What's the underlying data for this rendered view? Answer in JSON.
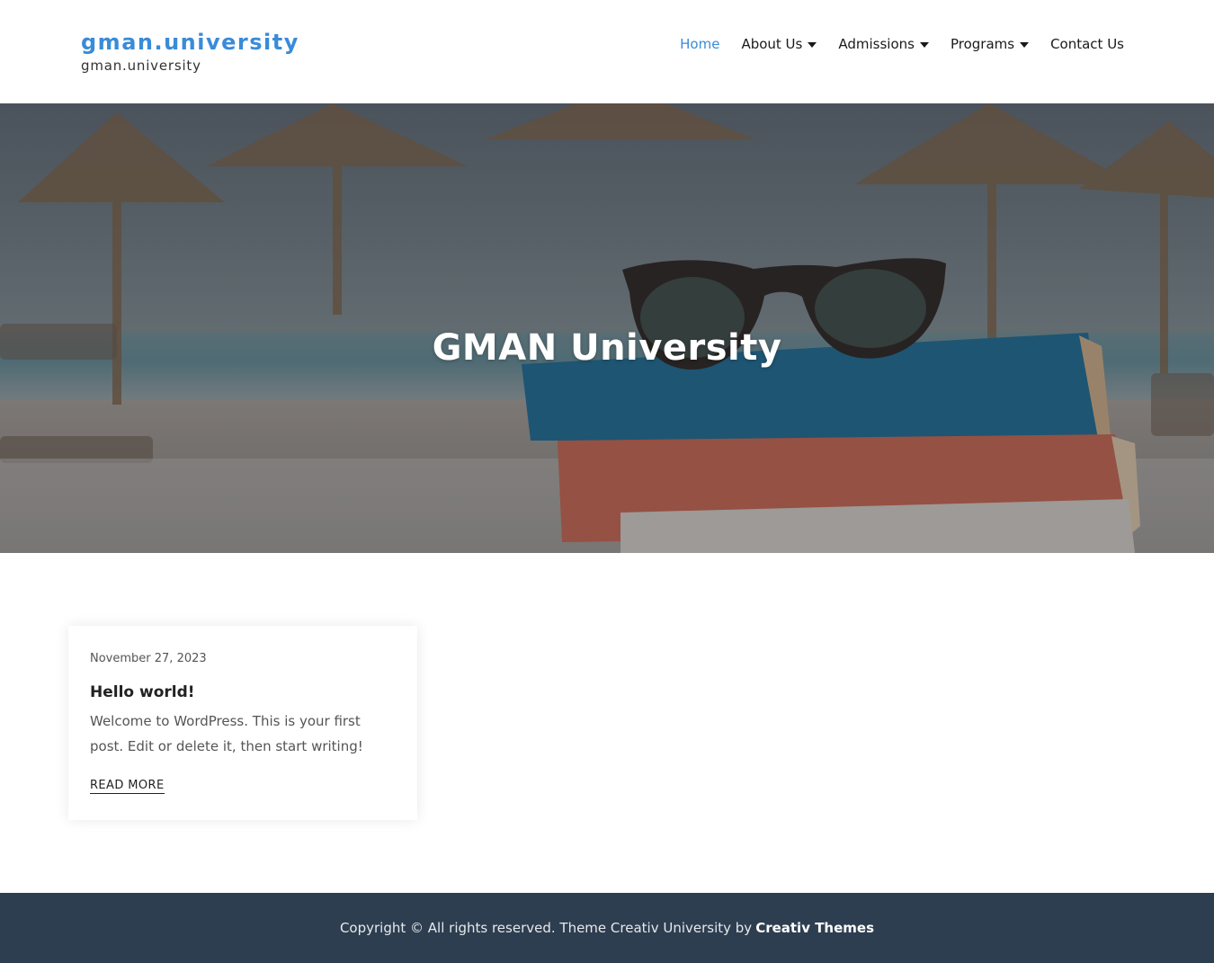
{
  "header": {
    "site_title": "gman.university",
    "tagline": "gman.university",
    "nav": [
      {
        "label": "Home",
        "active": true,
        "has_dropdown": false
      },
      {
        "label": "About Us",
        "active": false,
        "has_dropdown": true
      },
      {
        "label": "Admissions",
        "active": false,
        "has_dropdown": true
      },
      {
        "label": "Programs",
        "active": false,
        "has_dropdown": true
      },
      {
        "label": "Contact Us",
        "active": false,
        "has_dropdown": false
      }
    ]
  },
  "hero": {
    "title": "GMAN University"
  },
  "posts": [
    {
      "date": "November 27, 2023",
      "title": "Hello world!",
      "excerpt": "Welcome to WordPress. This is your first post. Edit or delete it, then start writing!",
      "read_more": "READ MORE"
    }
  ],
  "footer": {
    "text": "Copyright © All rights reserved. Theme Creativ University by",
    "brand": "Creativ Themes"
  },
  "colors": {
    "accent": "#3a8bd8",
    "footer_bg": "#2d3e50"
  },
  "icons": {
    "dropdown": "caret-down-icon"
  }
}
